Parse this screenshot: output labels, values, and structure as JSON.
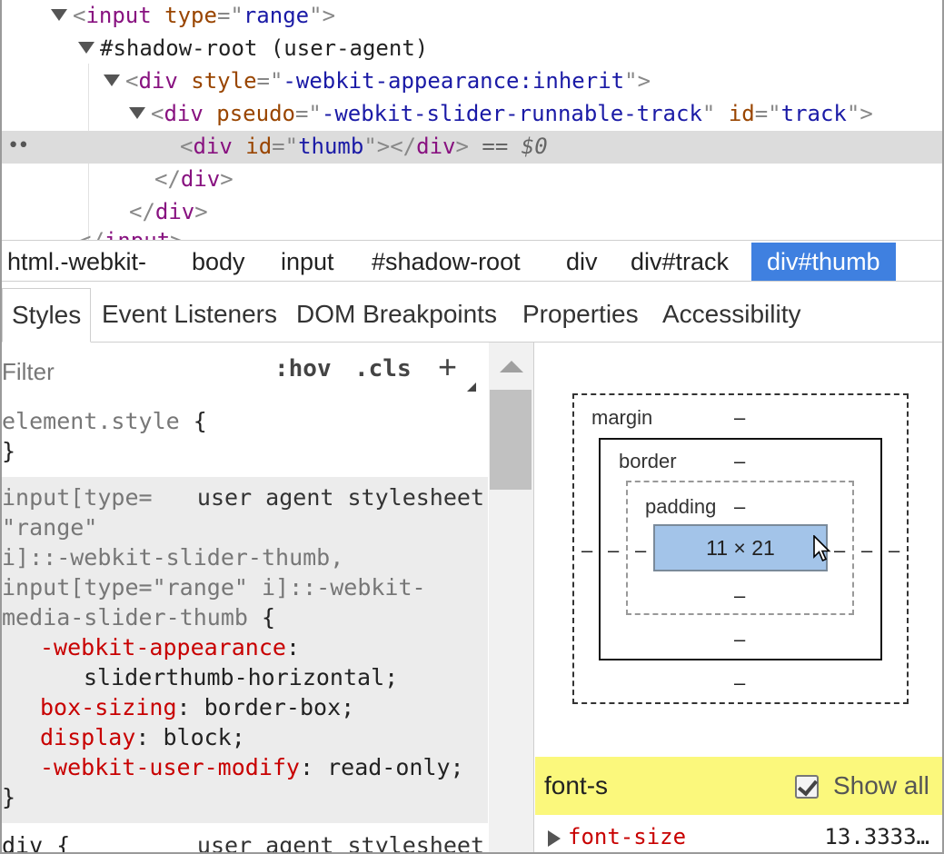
{
  "dom_tree": {
    "line1": {
      "open": "<",
      "tag": "input",
      "sp": " ",
      "attr": "type",
      "eq": "=",
      "q1": "\"",
      "val": "range",
      "q2": "\"",
      "close": ">"
    },
    "line2": {
      "text": "#shadow-root (user-agent)"
    },
    "line3": {
      "open": "<",
      "tag": "div",
      "sp": " ",
      "attr": "style",
      "eq": "=",
      "q1": "\"",
      "val": "-webkit-appearance:inherit",
      "q2": "\"",
      "close": ">"
    },
    "line4": {
      "open": "<",
      "tag": "div",
      "sp": " ",
      "attr1": "pseudo",
      "eq1": "=",
      "q1": "\"",
      "val1": "-webkit-slider-runnable-track",
      "q2": "\"",
      "sp2": " ",
      "attr2": "id",
      "eq2": "=",
      "q3": "\"",
      "val2": "track",
      "q4": "\"",
      "close": ">"
    },
    "line5": {
      "dots": "••",
      "open": "<",
      "tag": "div",
      "sp": " ",
      "attr": "id",
      "eq": "=",
      "q1": "\"",
      "val": "thumb",
      "q2": "\"",
      "mid": "></",
      "tag_close": "div",
      "close": ">",
      "marker": " == $0"
    },
    "line6": {
      "open": "</",
      "tag": "div",
      "close": ">"
    },
    "line7": {
      "open": "</",
      "tag": "div",
      "close": ">"
    },
    "line8": {
      "open": "</",
      "tag": "input",
      "close": ">"
    }
  },
  "breadcrumbs": [
    "html.-webkit-",
    "body",
    "input",
    "#shadow-root",
    "div",
    "div#track",
    "div#thumb"
  ],
  "tabs": [
    "Styles",
    "Event Listeners",
    "DOM Breakpoints",
    "Properties",
    "Accessibility"
  ],
  "styles": {
    "filter_placeholder": "Filter",
    "hov": ":hov",
    "cls": ".cls",
    "plus": "+",
    "element_style": {
      "selector": "element.style",
      "open": " {",
      "close": "}"
    },
    "ua_rule": {
      "selector_lines": [
        "input[type=",
        "\"range\"",
        "i]::-webkit-slider-thumb,",
        "input[type=\"range\" i]::-webkit-",
        "media-slider-thumb "
      ],
      "open": "{",
      "source": "user agent stylesheet",
      "declarations": [
        {
          "prop": "-webkit-appearance",
          "colon": ":",
          "value": ""
        },
        {
          "prop": "",
          "colon": "",
          "value": "sliderthumb-horizontal;"
        },
        {
          "prop": "box-sizing",
          "colon": ": ",
          "value": "border-box;"
        },
        {
          "prop": "display",
          "colon": ": ",
          "value": "block;"
        },
        {
          "prop": "-webkit-user-modify",
          "colon": ": ",
          "value": "read-only;"
        }
      ],
      "close": "}"
    },
    "div_rule": {
      "selector": "div {",
      "source": "user agent stylesheet"
    }
  },
  "box_model": {
    "margin_label": "margin",
    "border_label": "border",
    "padding_label": "padding",
    "content_size": "11 × 21",
    "dash": "–"
  },
  "computed": {
    "filter_value": "font-s",
    "show_all_label": "Show all",
    "show_all_checked": true,
    "property": "font-size",
    "value": "13.3333…"
  },
  "colors": {
    "accent": "#3f80e0",
    "tag": "#881280",
    "attr": "#994500",
    "value": "#1a1aa6",
    "css_prop": "#c80000",
    "highlight": "#fbf87c",
    "content_box": "#a3c4e9"
  }
}
